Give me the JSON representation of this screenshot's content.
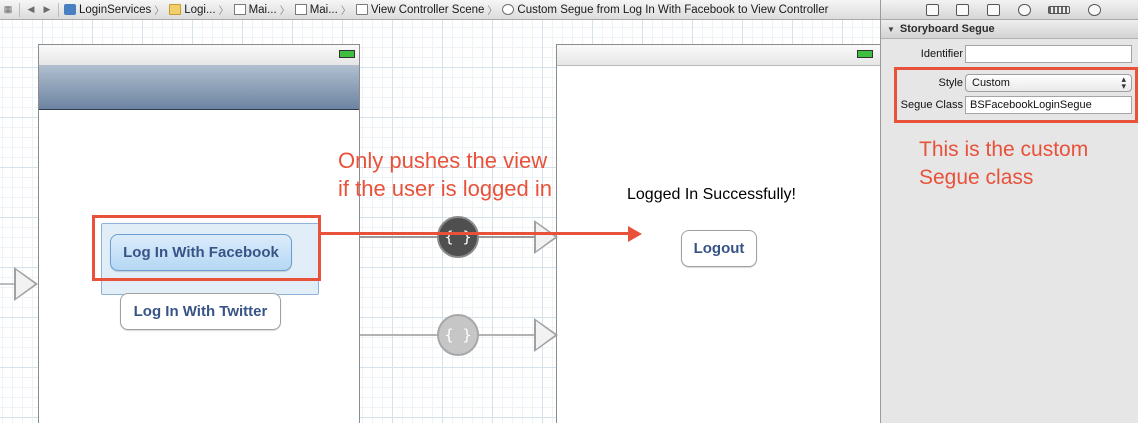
{
  "jumpbar": {
    "nav_grid": "grid-icon",
    "back": "◀",
    "forward": "▶",
    "crumbs": [
      {
        "label": "LoginServices",
        "icon": "project-icon"
      },
      {
        "label": "Logi...",
        "icon": "folder-icon"
      },
      {
        "label": "Mai...",
        "icon": "storyboard-file-icon"
      },
      {
        "label": "Mai...",
        "icon": "storyboard-file-icon"
      },
      {
        "label": "View Controller Scene",
        "icon": "scene-icon"
      },
      {
        "label": "Custom Segue from Log In With Facebook to View Controller",
        "icon": "segue-icon"
      }
    ]
  },
  "canvas": {
    "login_scene": {
      "facebook_button": "Log In With Facebook",
      "twitter_button": "Log In With Twitter"
    },
    "success_scene": {
      "message": "Logged In Successfully!",
      "logout_button": "Logout"
    },
    "segues": [
      {
        "symbol": "{ }",
        "state": "selected"
      },
      {
        "symbol": "{ }",
        "state": "unselected"
      }
    ]
  },
  "annotations": {
    "segue_note_line1": "Only pushes the view",
    "segue_note_line2": "if the user is logged in",
    "class_note_line1": "This is the custom",
    "class_note_line2": "Segue class",
    "color": "#e8523b"
  },
  "inspector": {
    "section_title": "Storyboard Segue",
    "identifier_label": "Identifier",
    "identifier_value": "",
    "style_label": "Style",
    "style_value": "Custom",
    "segue_class_label": "Segue Class",
    "segue_class_value": "BSFacebookLoginSegue"
  }
}
